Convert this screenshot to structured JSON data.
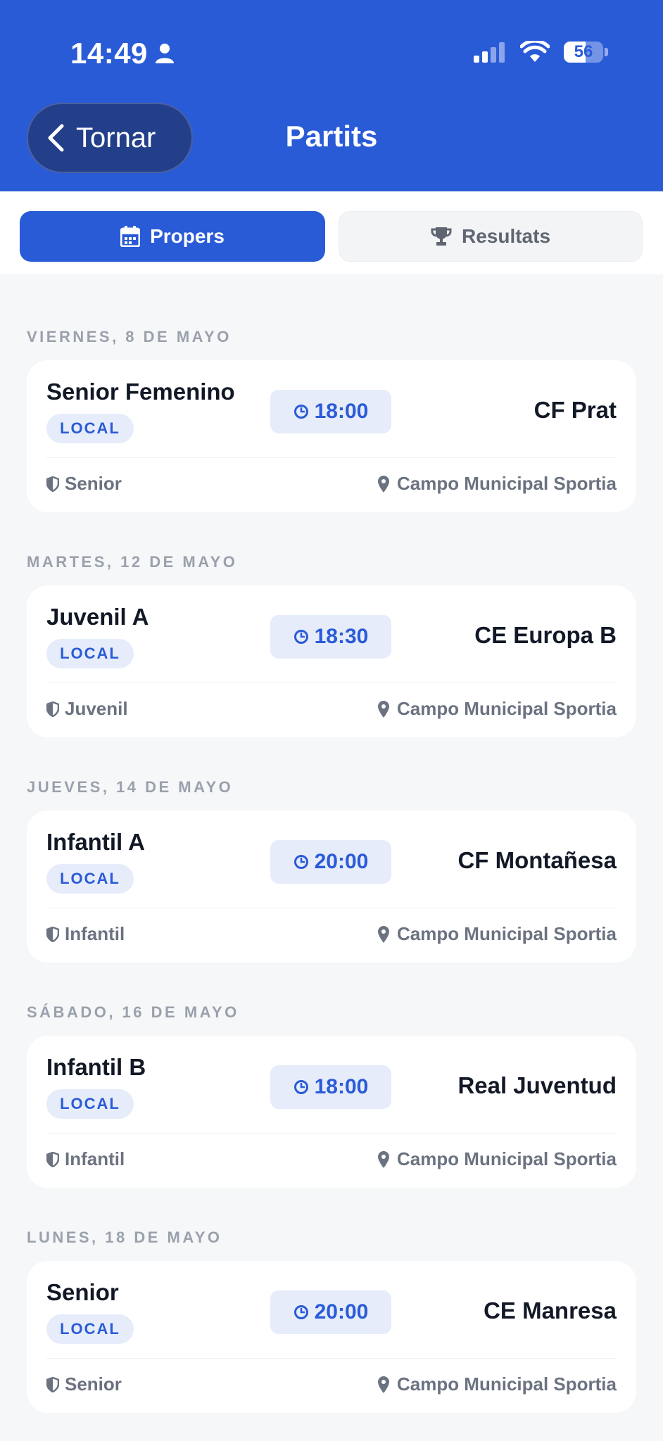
{
  "status_bar": {
    "time": "14:49",
    "battery": "56",
    "battery_level": 0.56
  },
  "header": {
    "back_label": "Tornar",
    "title": "Partits"
  },
  "tabs": [
    {
      "label": "Propers",
      "icon": "calendar-icon",
      "active": true
    },
    {
      "label": "Resultats",
      "icon": "trophy-icon",
      "active": false
    }
  ],
  "colors": {
    "primary": "#2A5BD7",
    "background": "#F5F7F8",
    "card": "#FFFFFF",
    "muted_text": "#9AA1AC"
  },
  "matches": [
    {
      "date": "VIERNES, 8 DE MAYO",
      "team": "Senior Femenino",
      "badge": "LOCAL",
      "time": "18:00",
      "opponent": "CF Prat",
      "category": "Senior",
      "venue": "Campo Municipal Sportia"
    },
    {
      "date": "MARTES, 12 DE MAYO",
      "team": "Juvenil A",
      "badge": "LOCAL",
      "time": "18:30",
      "opponent": "CE Europa B",
      "category": "Juvenil",
      "venue": "Campo Municipal Sportia"
    },
    {
      "date": "JUEVES, 14 DE MAYO",
      "team": "Infantil A",
      "badge": "LOCAL",
      "time": "20:00",
      "opponent": "CF Montañesa",
      "category": "Infantil",
      "venue": "Campo Municipal Sportia"
    },
    {
      "date": "SÁBADO, 16 DE MAYO",
      "team": "Infantil B",
      "badge": "LOCAL",
      "time": "18:00",
      "opponent": "Real Juventud",
      "category": "Infantil",
      "venue": "Campo Municipal Sportia"
    },
    {
      "date": "LUNES, 18 DE MAYO",
      "team": "Senior",
      "badge": "LOCAL",
      "time": "20:00",
      "opponent": "CE Manresa",
      "category": "Senior",
      "venue": "Campo Municipal Sportia"
    }
  ]
}
